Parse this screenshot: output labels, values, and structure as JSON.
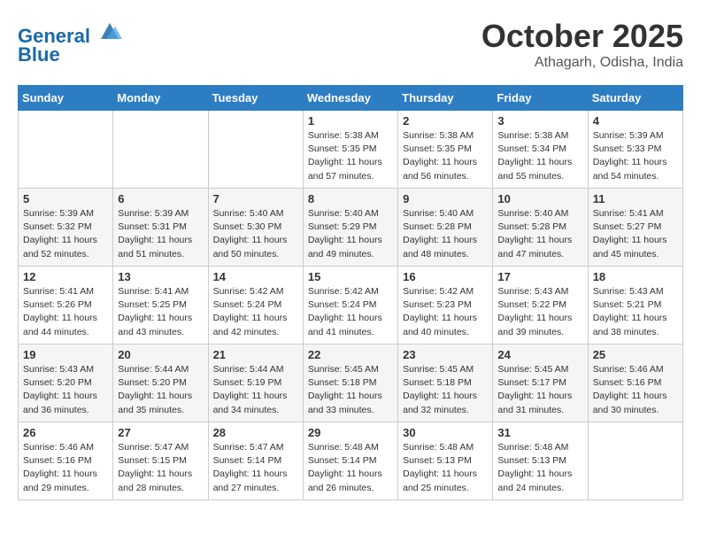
{
  "header": {
    "logo_line1": "General",
    "logo_line2": "Blue",
    "month": "October 2025",
    "location": "Athagarh, Odisha, India"
  },
  "weekdays": [
    "Sunday",
    "Monday",
    "Tuesday",
    "Wednesday",
    "Thursday",
    "Friday",
    "Saturday"
  ],
  "weeks": [
    [
      {
        "day": "",
        "info": ""
      },
      {
        "day": "",
        "info": ""
      },
      {
        "day": "",
        "info": ""
      },
      {
        "day": "1",
        "info": "Sunrise: 5:38 AM\nSunset: 5:35 PM\nDaylight: 11 hours\nand 57 minutes."
      },
      {
        "day": "2",
        "info": "Sunrise: 5:38 AM\nSunset: 5:35 PM\nDaylight: 11 hours\nand 56 minutes."
      },
      {
        "day": "3",
        "info": "Sunrise: 5:38 AM\nSunset: 5:34 PM\nDaylight: 11 hours\nand 55 minutes."
      },
      {
        "day": "4",
        "info": "Sunrise: 5:39 AM\nSunset: 5:33 PM\nDaylight: 11 hours\nand 54 minutes."
      }
    ],
    [
      {
        "day": "5",
        "info": "Sunrise: 5:39 AM\nSunset: 5:32 PM\nDaylight: 11 hours\nand 52 minutes."
      },
      {
        "day": "6",
        "info": "Sunrise: 5:39 AM\nSunset: 5:31 PM\nDaylight: 11 hours\nand 51 minutes."
      },
      {
        "day": "7",
        "info": "Sunrise: 5:40 AM\nSunset: 5:30 PM\nDaylight: 11 hours\nand 50 minutes."
      },
      {
        "day": "8",
        "info": "Sunrise: 5:40 AM\nSunset: 5:29 PM\nDaylight: 11 hours\nand 49 minutes."
      },
      {
        "day": "9",
        "info": "Sunrise: 5:40 AM\nSunset: 5:28 PM\nDaylight: 11 hours\nand 48 minutes."
      },
      {
        "day": "10",
        "info": "Sunrise: 5:40 AM\nSunset: 5:28 PM\nDaylight: 11 hours\nand 47 minutes."
      },
      {
        "day": "11",
        "info": "Sunrise: 5:41 AM\nSunset: 5:27 PM\nDaylight: 11 hours\nand 45 minutes."
      }
    ],
    [
      {
        "day": "12",
        "info": "Sunrise: 5:41 AM\nSunset: 5:26 PM\nDaylight: 11 hours\nand 44 minutes."
      },
      {
        "day": "13",
        "info": "Sunrise: 5:41 AM\nSunset: 5:25 PM\nDaylight: 11 hours\nand 43 minutes."
      },
      {
        "day": "14",
        "info": "Sunrise: 5:42 AM\nSunset: 5:24 PM\nDaylight: 11 hours\nand 42 minutes."
      },
      {
        "day": "15",
        "info": "Sunrise: 5:42 AM\nSunset: 5:24 PM\nDaylight: 11 hours\nand 41 minutes."
      },
      {
        "day": "16",
        "info": "Sunrise: 5:42 AM\nSunset: 5:23 PM\nDaylight: 11 hours\nand 40 minutes."
      },
      {
        "day": "17",
        "info": "Sunrise: 5:43 AM\nSunset: 5:22 PM\nDaylight: 11 hours\nand 39 minutes."
      },
      {
        "day": "18",
        "info": "Sunrise: 5:43 AM\nSunset: 5:21 PM\nDaylight: 11 hours\nand 38 minutes."
      }
    ],
    [
      {
        "day": "19",
        "info": "Sunrise: 5:43 AM\nSunset: 5:20 PM\nDaylight: 11 hours\nand 36 minutes."
      },
      {
        "day": "20",
        "info": "Sunrise: 5:44 AM\nSunset: 5:20 PM\nDaylight: 11 hours\nand 35 minutes."
      },
      {
        "day": "21",
        "info": "Sunrise: 5:44 AM\nSunset: 5:19 PM\nDaylight: 11 hours\nand 34 minutes."
      },
      {
        "day": "22",
        "info": "Sunrise: 5:45 AM\nSunset: 5:18 PM\nDaylight: 11 hours\nand 33 minutes."
      },
      {
        "day": "23",
        "info": "Sunrise: 5:45 AM\nSunset: 5:18 PM\nDaylight: 11 hours\nand 32 minutes."
      },
      {
        "day": "24",
        "info": "Sunrise: 5:45 AM\nSunset: 5:17 PM\nDaylight: 11 hours\nand 31 minutes."
      },
      {
        "day": "25",
        "info": "Sunrise: 5:46 AM\nSunset: 5:16 PM\nDaylight: 11 hours\nand 30 minutes."
      }
    ],
    [
      {
        "day": "26",
        "info": "Sunrise: 5:46 AM\nSunset: 5:16 PM\nDaylight: 11 hours\nand 29 minutes."
      },
      {
        "day": "27",
        "info": "Sunrise: 5:47 AM\nSunset: 5:15 PM\nDaylight: 11 hours\nand 28 minutes."
      },
      {
        "day": "28",
        "info": "Sunrise: 5:47 AM\nSunset: 5:14 PM\nDaylight: 11 hours\nand 27 minutes."
      },
      {
        "day": "29",
        "info": "Sunrise: 5:48 AM\nSunset: 5:14 PM\nDaylight: 11 hours\nand 26 minutes."
      },
      {
        "day": "30",
        "info": "Sunrise: 5:48 AM\nSunset: 5:13 PM\nDaylight: 11 hours\nand 25 minutes."
      },
      {
        "day": "31",
        "info": "Sunrise: 5:48 AM\nSunset: 5:13 PM\nDaylight: 11 hours\nand 24 minutes."
      },
      {
        "day": "",
        "info": ""
      }
    ]
  ]
}
